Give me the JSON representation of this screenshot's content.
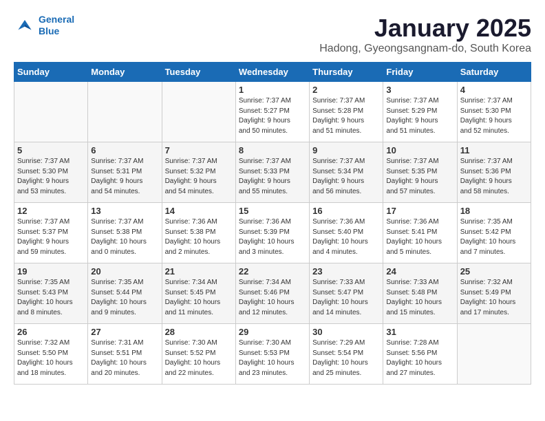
{
  "header": {
    "logo_line1": "General",
    "logo_line2": "Blue",
    "month": "January 2025",
    "location": "Hadong, Gyeongsangnam-do, South Korea"
  },
  "weekdays": [
    "Sunday",
    "Monday",
    "Tuesday",
    "Wednesday",
    "Thursday",
    "Friday",
    "Saturday"
  ],
  "weeks": [
    [
      {
        "day": "",
        "info": ""
      },
      {
        "day": "",
        "info": ""
      },
      {
        "day": "",
        "info": ""
      },
      {
        "day": "1",
        "info": "Sunrise: 7:37 AM\nSunset: 5:27 PM\nDaylight: 9 hours\nand 50 minutes."
      },
      {
        "day": "2",
        "info": "Sunrise: 7:37 AM\nSunset: 5:28 PM\nDaylight: 9 hours\nand 51 minutes."
      },
      {
        "day": "3",
        "info": "Sunrise: 7:37 AM\nSunset: 5:29 PM\nDaylight: 9 hours\nand 51 minutes."
      },
      {
        "day": "4",
        "info": "Sunrise: 7:37 AM\nSunset: 5:30 PM\nDaylight: 9 hours\nand 52 minutes."
      }
    ],
    [
      {
        "day": "5",
        "info": "Sunrise: 7:37 AM\nSunset: 5:30 PM\nDaylight: 9 hours\nand 53 minutes."
      },
      {
        "day": "6",
        "info": "Sunrise: 7:37 AM\nSunset: 5:31 PM\nDaylight: 9 hours\nand 54 minutes."
      },
      {
        "day": "7",
        "info": "Sunrise: 7:37 AM\nSunset: 5:32 PM\nDaylight: 9 hours\nand 54 minutes."
      },
      {
        "day": "8",
        "info": "Sunrise: 7:37 AM\nSunset: 5:33 PM\nDaylight: 9 hours\nand 55 minutes."
      },
      {
        "day": "9",
        "info": "Sunrise: 7:37 AM\nSunset: 5:34 PM\nDaylight: 9 hours\nand 56 minutes."
      },
      {
        "day": "10",
        "info": "Sunrise: 7:37 AM\nSunset: 5:35 PM\nDaylight: 9 hours\nand 57 minutes."
      },
      {
        "day": "11",
        "info": "Sunrise: 7:37 AM\nSunset: 5:36 PM\nDaylight: 9 hours\nand 58 minutes."
      }
    ],
    [
      {
        "day": "12",
        "info": "Sunrise: 7:37 AM\nSunset: 5:37 PM\nDaylight: 9 hours\nand 59 minutes."
      },
      {
        "day": "13",
        "info": "Sunrise: 7:37 AM\nSunset: 5:38 PM\nDaylight: 10 hours\nand 0 minutes."
      },
      {
        "day": "14",
        "info": "Sunrise: 7:36 AM\nSunset: 5:38 PM\nDaylight: 10 hours\nand 2 minutes."
      },
      {
        "day": "15",
        "info": "Sunrise: 7:36 AM\nSunset: 5:39 PM\nDaylight: 10 hours\nand 3 minutes."
      },
      {
        "day": "16",
        "info": "Sunrise: 7:36 AM\nSunset: 5:40 PM\nDaylight: 10 hours\nand 4 minutes."
      },
      {
        "day": "17",
        "info": "Sunrise: 7:36 AM\nSunset: 5:41 PM\nDaylight: 10 hours\nand 5 minutes."
      },
      {
        "day": "18",
        "info": "Sunrise: 7:35 AM\nSunset: 5:42 PM\nDaylight: 10 hours\nand 7 minutes."
      }
    ],
    [
      {
        "day": "19",
        "info": "Sunrise: 7:35 AM\nSunset: 5:43 PM\nDaylight: 10 hours\nand 8 minutes."
      },
      {
        "day": "20",
        "info": "Sunrise: 7:35 AM\nSunset: 5:44 PM\nDaylight: 10 hours\nand 9 minutes."
      },
      {
        "day": "21",
        "info": "Sunrise: 7:34 AM\nSunset: 5:45 PM\nDaylight: 10 hours\nand 11 minutes."
      },
      {
        "day": "22",
        "info": "Sunrise: 7:34 AM\nSunset: 5:46 PM\nDaylight: 10 hours\nand 12 minutes."
      },
      {
        "day": "23",
        "info": "Sunrise: 7:33 AM\nSunset: 5:47 PM\nDaylight: 10 hours\nand 14 minutes."
      },
      {
        "day": "24",
        "info": "Sunrise: 7:33 AM\nSunset: 5:48 PM\nDaylight: 10 hours\nand 15 minutes."
      },
      {
        "day": "25",
        "info": "Sunrise: 7:32 AM\nSunset: 5:49 PM\nDaylight: 10 hours\nand 17 minutes."
      }
    ],
    [
      {
        "day": "26",
        "info": "Sunrise: 7:32 AM\nSunset: 5:50 PM\nDaylight: 10 hours\nand 18 minutes."
      },
      {
        "day": "27",
        "info": "Sunrise: 7:31 AM\nSunset: 5:51 PM\nDaylight: 10 hours\nand 20 minutes."
      },
      {
        "day": "28",
        "info": "Sunrise: 7:30 AM\nSunset: 5:52 PM\nDaylight: 10 hours\nand 22 minutes."
      },
      {
        "day": "29",
        "info": "Sunrise: 7:30 AM\nSunset: 5:53 PM\nDaylight: 10 hours\nand 23 minutes."
      },
      {
        "day": "30",
        "info": "Sunrise: 7:29 AM\nSunset: 5:54 PM\nDaylight: 10 hours\nand 25 minutes."
      },
      {
        "day": "31",
        "info": "Sunrise: 7:28 AM\nSunset: 5:56 PM\nDaylight: 10 hours\nand 27 minutes."
      },
      {
        "day": "",
        "info": ""
      }
    ]
  ]
}
